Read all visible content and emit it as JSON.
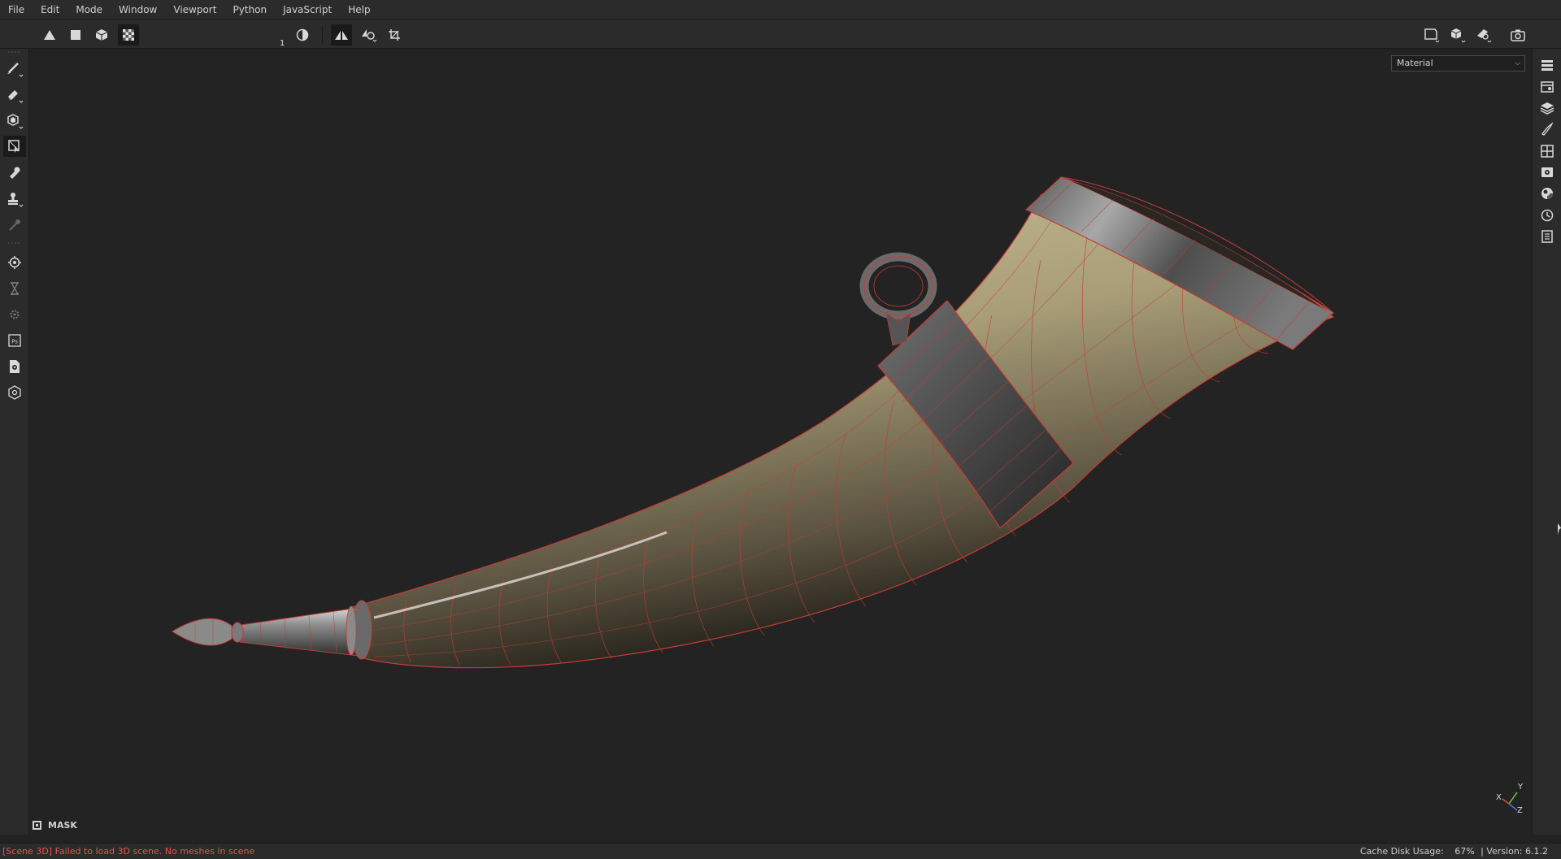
{
  "menubar": {
    "items": [
      "File",
      "Edit",
      "Mode",
      "Window",
      "Viewport",
      "Python",
      "JavaScript",
      "Help"
    ]
  },
  "toolbar": {
    "opacity_value": "1",
    "tools": [
      "triangle-fill-icon",
      "square-fill-icon",
      "cube-icon",
      "checker-icon",
      "contrast-icon",
      "symmetry-icon",
      "symmetry-settings-icon",
      "crop-icon"
    ]
  },
  "left_tools": [
    "paint-brush-icon",
    "eraser-icon",
    "projection-icon",
    "polygon-fill-icon",
    "smudge-icon",
    "clone-stamp-icon",
    "color-picker-icon",
    "bake-icon",
    "hourglass-icon",
    "settings-small-icon",
    "photoshop-icon",
    "export-icon",
    "plugin-icon"
  ],
  "right_tools": [
    "layers-list-icon",
    "texture-set-icon",
    "layers-icon",
    "brush-settings-icon",
    "grid-icon",
    "display-settings-icon",
    "shader-icon",
    "history-icon",
    "log-icon"
  ],
  "top_right_tools": [
    "camera-frame-icon",
    "cube-view-icon",
    "render-icon",
    "screenshot-icon"
  ],
  "viewport": {
    "mode": "Material",
    "mask_label": "MASK",
    "axes": {
      "x": "X",
      "y": "Y",
      "z": "Z"
    }
  },
  "status": {
    "error": "[Scene 3D] Failed to load 3D scene. No meshes in scene",
    "cache_label": "Cache Disk Usage:",
    "cache_value": "67%",
    "version": "| Version: 6.1.2"
  },
  "colors": {
    "accent_error": "#e0574a",
    "wireframe": "#c43c34",
    "panel": "#2b2b2b",
    "viewport_bg": "#232323"
  }
}
